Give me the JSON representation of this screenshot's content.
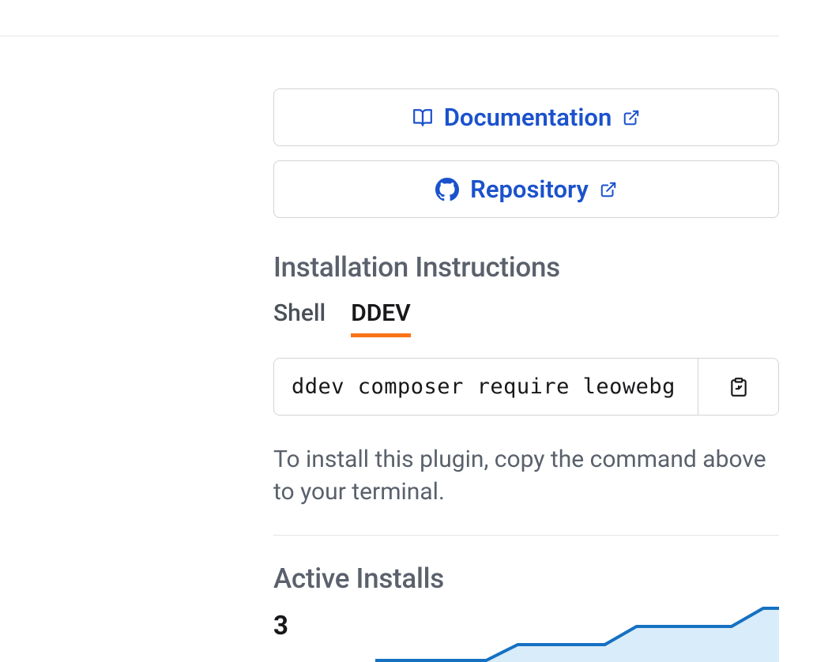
{
  "links": {
    "documentation": "Documentation",
    "repository": "Repository"
  },
  "install": {
    "title": "Installation Instructions",
    "tabs": {
      "shell": "Shell",
      "ddev": "DDEV"
    },
    "command": "ddev composer require leowebg",
    "help": "To install this plugin, copy the command above to your terminal."
  },
  "stats": {
    "title": "Active Installs",
    "value": "3"
  },
  "chart_data": {
    "type": "area",
    "x": [
      0,
      1,
      2,
      3,
      4,
      5,
      6,
      7
    ],
    "values": [
      0,
      0,
      0,
      1,
      1,
      2,
      2,
      3
    ],
    "ylim": [
      0,
      3
    ]
  },
  "colors": {
    "link": "#1b52cc",
    "accent": "#f97316",
    "chartStroke": "#1571c2",
    "chartFill": "#d9ecf9"
  }
}
